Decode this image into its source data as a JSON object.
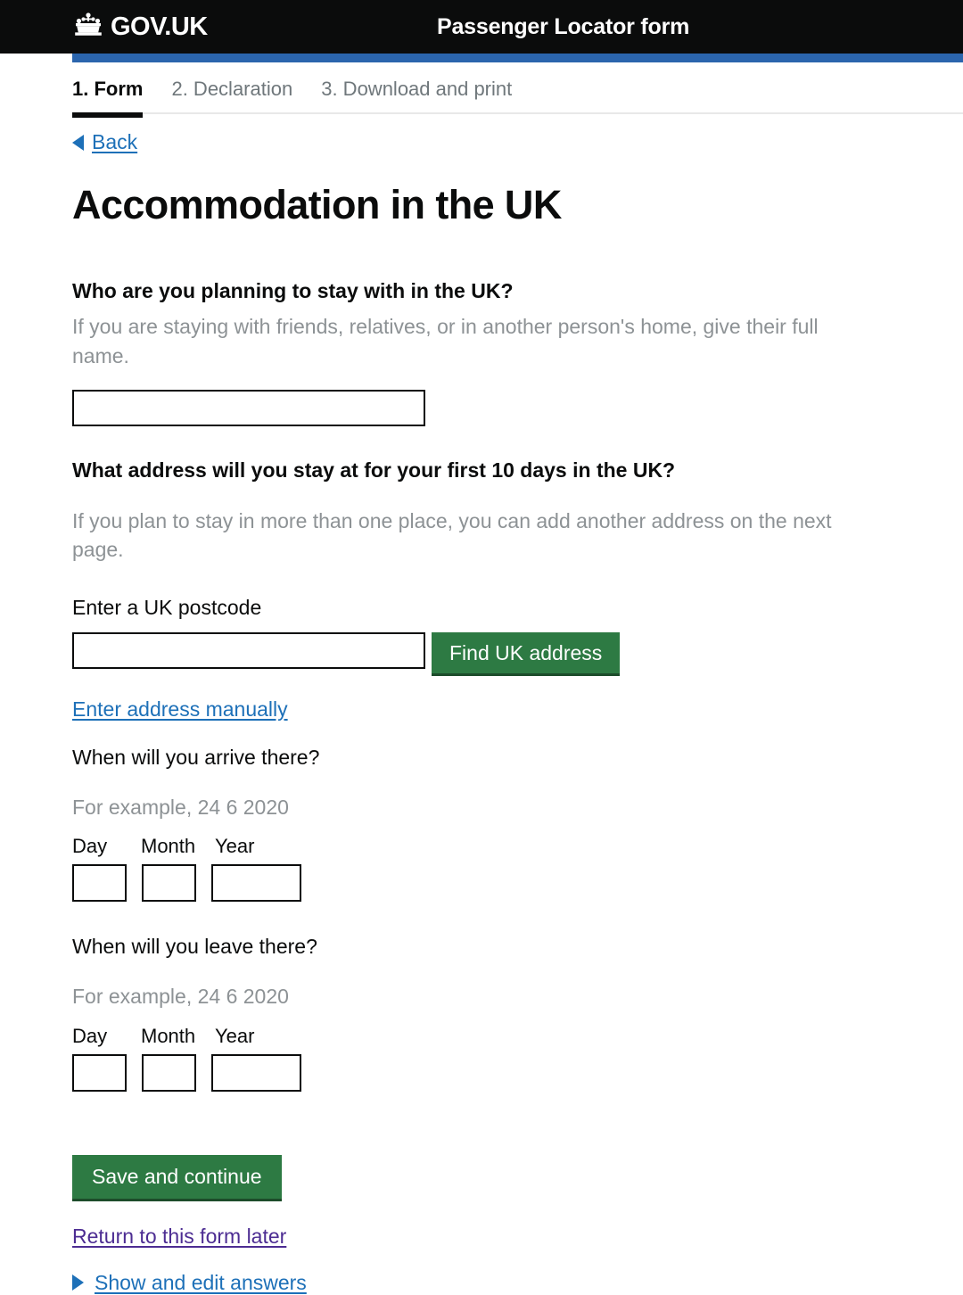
{
  "header": {
    "brand": "GOV.UK",
    "crown_icon": "crown-icon",
    "service_title": "Passenger Locator form"
  },
  "tabs": [
    {
      "label": "1. Form",
      "active": true
    },
    {
      "label": "2. Declaration",
      "active": false
    },
    {
      "label": "3. Download and print",
      "active": false
    }
  ],
  "back_link": {
    "label": "Back",
    "icon": "arrow-left-icon"
  },
  "page": {
    "title": "Accommodation in the UK"
  },
  "questions": {
    "stay_with": {
      "label": "Who are you planning to stay with in the UK?",
      "hint": "If you are staying with friends, relatives, or in another person's home, give their full name.",
      "value": "",
      "placeholder": ""
    },
    "address": {
      "label": "What address will you stay at for your first 10 days in the UK?",
      "hint": "If you plan to stay in more than one place, you can add another address on the next page.",
      "postcode_label": "Enter a UK postcode",
      "postcode_value": "",
      "postcode_placeholder": "",
      "find_button": "Find UK address",
      "manual_link": "Enter address manually"
    },
    "arrive": {
      "label": "When will you arrive there?",
      "hint": "For example, 24 6 2020",
      "day_label": "Day",
      "month_label": "Month",
      "year_label": "Year",
      "day_value": "",
      "month_value": "",
      "year_value": ""
    },
    "leave": {
      "label": "When will you leave there?",
      "hint": "For example, 24 6 2020",
      "day_label": "Day",
      "month_label": "Month",
      "year_label": "Year",
      "day_value": "",
      "month_value": "",
      "year_value": ""
    }
  },
  "actions": {
    "save_continue": "Save and continue",
    "return_later": "Return to this form later",
    "show_answers": "Show and edit answers",
    "show_answers_icon": "triangle-right-icon"
  },
  "colors": {
    "header_background": "#0b0c0c",
    "blue_bar": "#2b65ad",
    "button_green": "#2d7a43",
    "link_blue": "#1d70b8",
    "link_visited_purple": "#4c2c92",
    "hint_grey": "#8d9295"
  }
}
